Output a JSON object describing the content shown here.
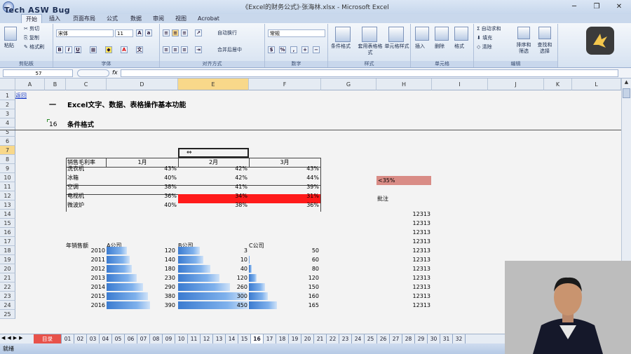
{
  "window": {
    "title": "《Excel的财务公式》·张海林.xlsx - Microsoft Excel",
    "watermark": "Tech ASW Bug"
  },
  "ribbon_tabs": [
    "开始",
    "插入",
    "页面布局",
    "公式",
    "数据",
    "审阅",
    "视图",
    "Acrobat"
  ],
  "ribbon": {
    "clipboard": {
      "paste": "粘贴",
      "cut": "剪切",
      "copy": "复制",
      "format_painter": "格式刷",
      "label": "剪贴板"
    },
    "font": {
      "name": "宋体",
      "size": "11",
      "label": "字体"
    },
    "alignment": {
      "wrap": "自动换行",
      "merge": "合并后居中",
      "label": "对齐方式"
    },
    "number": {
      "format": "常规",
      "label": "数字"
    },
    "styles": {
      "conditional": "条件格式",
      "table": "套用表格格式",
      "cell": "单元格样式",
      "label": "样式"
    },
    "cells": {
      "insert": "插入",
      "delete": "删除",
      "format": "格式",
      "label": "单元格"
    },
    "editing": {
      "autosum": "自动求和",
      "fill": "填充",
      "clear": "清除",
      "sort": "排序和筛选",
      "find": "查找和选择",
      "label": "编辑"
    }
  },
  "formula_bar": {
    "name_box": "57",
    "fx": "fx",
    "content": ""
  },
  "columns": [
    "A",
    "B",
    "C",
    "D",
    "E",
    "F",
    "G",
    "H",
    "I",
    "J",
    "K",
    "L"
  ],
  "rows": [
    "1",
    "2",
    "3",
    "4",
    "5",
    "6",
    "7",
    "8",
    "9",
    "10",
    "11",
    "12",
    "13",
    "14",
    "15",
    "16",
    "17",
    "18",
    "19",
    "20",
    "21",
    "22",
    "23",
    "24",
    "25"
  ],
  "sheet": {
    "back_link": "返回",
    "section_num": "一",
    "section_title": "Excel文字、数据、表格操作基本功能",
    "sub_num": "16",
    "sub_title": "条件格式",
    "table": {
      "header": [
        "销售毛利率",
        "1月",
        "2月",
        "3月"
      ],
      "rows": [
        {
          "name": "洗衣机",
          "v": [
            "43%",
            "42%",
            "43%"
          ]
        },
        {
          "name": "冰箱",
          "v": [
            "40%",
            "42%",
            "44%"
          ]
        },
        {
          "name": "空调",
          "v": [
            "38%",
            "41%",
            "39%"
          ]
        },
        {
          "name": "电视机",
          "v": [
            "36%",
            "34%",
            "31%"
          ]
        },
        {
          "name": "微波炉",
          "v": [
            "40%",
            "38%",
            "36%"
          ]
        }
      ]
    },
    "legend_cell": "<35%",
    "note_label": "批注",
    "repeat_value": "12313",
    "sales": {
      "title": "年销售额",
      "companies": [
        "A公司",
        "B公司",
        "C公司"
      ],
      "rows": [
        {
          "year": "2010",
          "a": "",
          "b": "120",
          "c": "3",
          "d": "50"
        },
        {
          "year": "2011",
          "a": "",
          "b": "140",
          "c": "10",
          "d": "60"
        },
        {
          "year": "2012",
          "a": "",
          "b": "180",
          "c": "40",
          "d": "80"
        },
        {
          "year": "2013",
          "a": "",
          "b": "230",
          "c": "120",
          "d": "120"
        },
        {
          "year": "2014",
          "a": "",
          "b": "290",
          "c": "260",
          "d": "150"
        },
        {
          "year": "2015",
          "a": "",
          "b": "380",
          "c": "300",
          "d": "160"
        },
        {
          "year": "2016",
          "a": "",
          "b": "390",
          "c": "450",
          "d": "165"
        }
      ]
    }
  },
  "chart_data": {
    "type": "bar",
    "title": "年销售额",
    "categories": [
      "2010",
      "2011",
      "2012",
      "2013",
      "2014",
      "2015",
      "2016"
    ],
    "series": [
      {
        "name": "A公司",
        "values": [
          85,
          95,
          105,
          125,
          150,
          170,
          180
        ]
      },
      {
        "name": "B公司",
        "values": [
          120,
          140,
          180,
          230,
          290,
          380,
          390
        ]
      },
      {
        "name": "C公司",
        "values": [
          3,
          10,
          40,
          120,
          260,
          300,
          450
        ]
      }
    ]
  },
  "sheet_tabs": [
    "目录",
    "01",
    "02",
    "03",
    "04",
    "05",
    "06",
    "07",
    "08",
    "09",
    "10",
    "11",
    "12",
    "13",
    "14",
    "15",
    "16",
    "17",
    "18",
    "19",
    "20",
    "21",
    "22",
    "23",
    "24",
    "25",
    "26",
    "27",
    "28",
    "29",
    "30",
    "31",
    "32"
  ],
  "active_sheet_tab": "16",
  "status": {
    "ready": "就绪"
  },
  "colors": {
    "red_fill": "#ff1a1a",
    "pink_fill": "#d98c86",
    "accent": "#f8d88a"
  }
}
